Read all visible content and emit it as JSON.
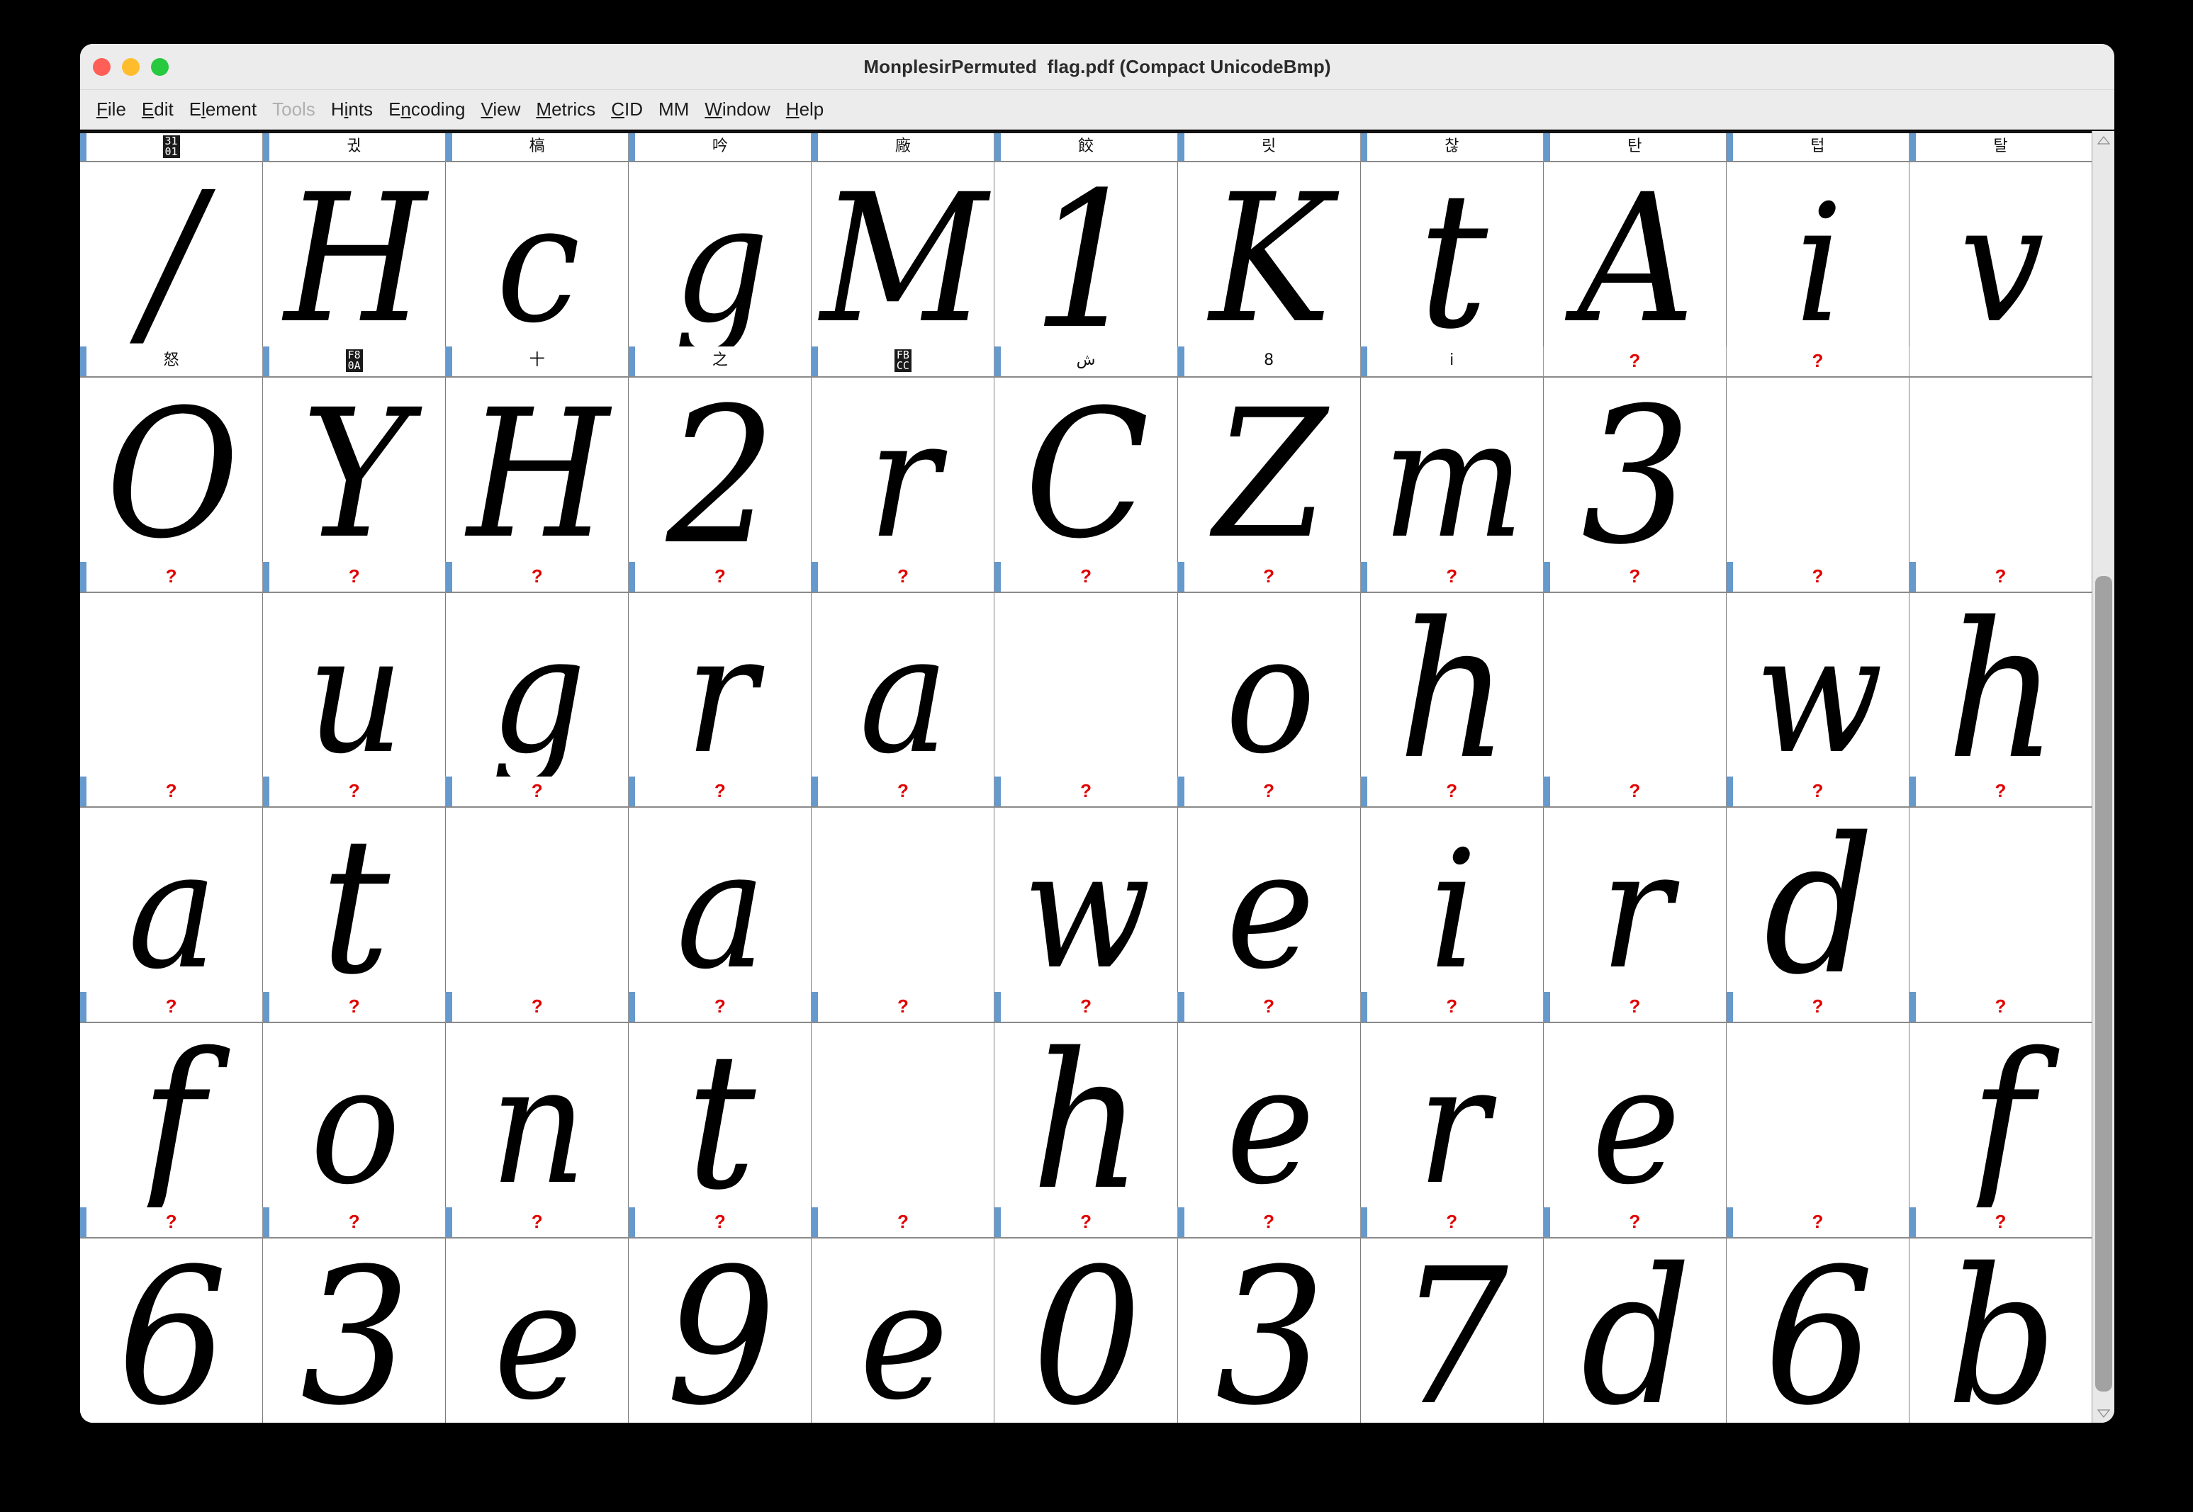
{
  "window": {
    "title": "MonplesirPermuted  flag.pdf (Compact UnicodeBmp)",
    "traffic_lights": [
      {
        "name": "close",
        "color": "#ff5f56"
      },
      {
        "name": "minimize",
        "color": "#ffbd2e"
      },
      {
        "name": "zoom",
        "color": "#27c93f"
      }
    ]
  },
  "menubar": {
    "items": [
      {
        "label": "File",
        "mnemonic": "F",
        "disabled": false
      },
      {
        "label": "Edit",
        "mnemonic": "E",
        "disabled": false
      },
      {
        "label": "Element",
        "mnemonic": "l",
        "disabled": false
      },
      {
        "label": "Tools",
        "mnemonic": "",
        "disabled": true
      },
      {
        "label": "Hints",
        "mnemonic": "i",
        "disabled": false
      },
      {
        "label": "Encoding",
        "mnemonic": "n",
        "disabled": false
      },
      {
        "label": "View",
        "mnemonic": "V",
        "disabled": false
      },
      {
        "label": "Metrics",
        "mnemonic": "M",
        "disabled": false
      },
      {
        "label": "CID",
        "mnemonic": "C",
        "disabled": false
      },
      {
        "label": "MM",
        "mnemonic": "",
        "disabled": false
      },
      {
        "label": "Window",
        "mnemonic": "W",
        "disabled": false
      },
      {
        "label": "Help",
        "mnemonic": "H",
        "disabled": false
      }
    ]
  },
  "colors": {
    "selection_tab": "#6699cc",
    "unencoded_marker": "#e00000",
    "window_chrome": "#ececec",
    "grid_line": "#7d7d7d",
    "scrollbar_thumb": "#a2a2a2"
  },
  "glyph_grid": {
    "columns": 11,
    "rows": [
      {
        "index": 0,
        "headers": [
          {
            "label": "3101",
            "type": "hex",
            "selected": true
          },
          {
            "label": "귔",
            "type": "glyph",
            "selected": true
          },
          {
            "label": "槁",
            "type": "glyph",
            "selected": true
          },
          {
            "label": "吟",
            "type": "glyph",
            "selected": true
          },
          {
            "label": "廠",
            "type": "glyph",
            "selected": true
          },
          {
            "label": "餃",
            "type": "glyph",
            "selected": true
          },
          {
            "label": "릿",
            "type": "glyph",
            "selected": true
          },
          {
            "label": "찮",
            "type": "glyph",
            "selected": true
          },
          {
            "label": "탄",
            "type": "glyph",
            "selected": true
          },
          {
            "label": "텁",
            "type": "glyph",
            "selected": true
          },
          {
            "label": "탈",
            "type": "glyph",
            "selected": true
          }
        ],
        "glyphs": [
          "/",
          "H",
          "c",
          "g",
          "M",
          "1",
          "K",
          "t",
          "A",
          "i",
          "v"
        ]
      },
      {
        "index": 1,
        "headers": [
          {
            "label": "怒",
            "type": "glyph",
            "selected": true
          },
          {
            "label": "F80A",
            "type": "hex",
            "selected": true
          },
          {
            "label": "十",
            "type": "glyph",
            "selected": true
          },
          {
            "label": "之",
            "type": "glyph",
            "selected": true
          },
          {
            "label": "FBCC",
            "type": "hex",
            "selected": true
          },
          {
            "label": "ش",
            "type": "glyph",
            "selected": true
          },
          {
            "label": "8",
            "type": "glyph",
            "selected": true
          },
          {
            "label": "i",
            "type": "glyph",
            "selected": true
          },
          {
            "label": "?",
            "type": "unencoded",
            "selected": false
          },
          {
            "label": "?",
            "type": "unencoded",
            "selected": false
          },
          {
            "label": "",
            "type": "blank",
            "selected": false
          }
        ],
        "glyphs": [
          "O",
          "Y",
          "H",
          "2",
          "r",
          "C",
          "Z",
          "m",
          "3",
          "",
          ""
        ]
      },
      {
        "index": 2,
        "headers": [
          {
            "label": "?",
            "type": "unencoded",
            "selected": true
          },
          {
            "label": "?",
            "type": "unencoded",
            "selected": true
          },
          {
            "label": "?",
            "type": "unencoded",
            "selected": true
          },
          {
            "label": "?",
            "type": "unencoded",
            "selected": true
          },
          {
            "label": "?",
            "type": "unencoded",
            "selected": true
          },
          {
            "label": "?",
            "type": "unencoded",
            "selected": true
          },
          {
            "label": "?",
            "type": "unencoded",
            "selected": true
          },
          {
            "label": "?",
            "type": "unencoded",
            "selected": true
          },
          {
            "label": "?",
            "type": "unencoded",
            "selected": true
          },
          {
            "label": "?",
            "type": "unencoded",
            "selected": true
          },
          {
            "label": "?",
            "type": "unencoded",
            "selected": true
          }
        ],
        "glyphs": [
          "",
          "u",
          "g",
          "r",
          "a",
          "_",
          "o",
          "h",
          "_",
          "w",
          "h"
        ]
      },
      {
        "index": 3,
        "headers": [
          {
            "label": "?",
            "type": "unencoded",
            "selected": true
          },
          {
            "label": "?",
            "type": "unencoded",
            "selected": true
          },
          {
            "label": "?",
            "type": "unencoded",
            "selected": true
          },
          {
            "label": "?",
            "type": "unencoded",
            "selected": true
          },
          {
            "label": "?",
            "type": "unencoded",
            "selected": true
          },
          {
            "label": "?",
            "type": "unencoded",
            "selected": true
          },
          {
            "label": "?",
            "type": "unencoded",
            "selected": true
          },
          {
            "label": "?",
            "type": "unencoded",
            "selected": true
          },
          {
            "label": "?",
            "type": "unencoded",
            "selected": true
          },
          {
            "label": "?",
            "type": "unencoded",
            "selected": true
          },
          {
            "label": "?",
            "type": "unencoded",
            "selected": true
          }
        ],
        "glyphs": [
          "a",
          "t",
          "_",
          "a",
          "_",
          "w",
          "e",
          "i",
          "r",
          "d",
          "_"
        ]
      },
      {
        "index": 4,
        "headers": [
          {
            "label": "?",
            "type": "unencoded",
            "selected": true
          },
          {
            "label": "?",
            "type": "unencoded",
            "selected": true
          },
          {
            "label": "?",
            "type": "unencoded",
            "selected": true
          },
          {
            "label": "?",
            "type": "unencoded",
            "selected": true
          },
          {
            "label": "?",
            "type": "unencoded",
            "selected": true
          },
          {
            "label": "?",
            "type": "unencoded",
            "selected": true
          },
          {
            "label": "?",
            "type": "unencoded",
            "selected": true
          },
          {
            "label": "?",
            "type": "unencoded",
            "selected": true
          },
          {
            "label": "?",
            "type": "unencoded",
            "selected": true
          },
          {
            "label": "?",
            "type": "unencoded",
            "selected": true
          },
          {
            "label": "?",
            "type": "unencoded",
            "selected": true
          }
        ],
        "glyphs": [
          "f",
          "o",
          "n",
          "t",
          "_",
          "h",
          "e",
          "r",
          "e",
          "_",
          "f"
        ]
      },
      {
        "index": 5,
        "headers": [
          {
            "label": "?",
            "type": "unencoded",
            "selected": true
          },
          {
            "label": "?",
            "type": "unencoded",
            "selected": true
          },
          {
            "label": "?",
            "type": "unencoded",
            "selected": true
          },
          {
            "label": "?",
            "type": "unencoded",
            "selected": true
          },
          {
            "label": "?",
            "type": "unencoded",
            "selected": true
          },
          {
            "label": "?",
            "type": "unencoded",
            "selected": true
          },
          {
            "label": "?",
            "type": "unencoded",
            "selected": true
          },
          {
            "label": "?",
            "type": "unencoded",
            "selected": true
          },
          {
            "label": "?",
            "type": "unencoded",
            "selected": true
          },
          {
            "label": "?",
            "type": "unencoded",
            "selected": true
          },
          {
            "label": "?",
            "type": "unencoded",
            "selected": true
          }
        ],
        "glyphs": [
          "6",
          "3",
          "e",
          "9",
          "e",
          "0",
          "3",
          "7",
          "d",
          "6",
          "b"
        ]
      }
    ]
  },
  "scrollbar": {
    "up_arrow": "triangle-up-icon",
    "down_arrow": "triangle-down-icon",
    "thumb_top_percent": 34,
    "thumb_bottom_percent": 1
  }
}
